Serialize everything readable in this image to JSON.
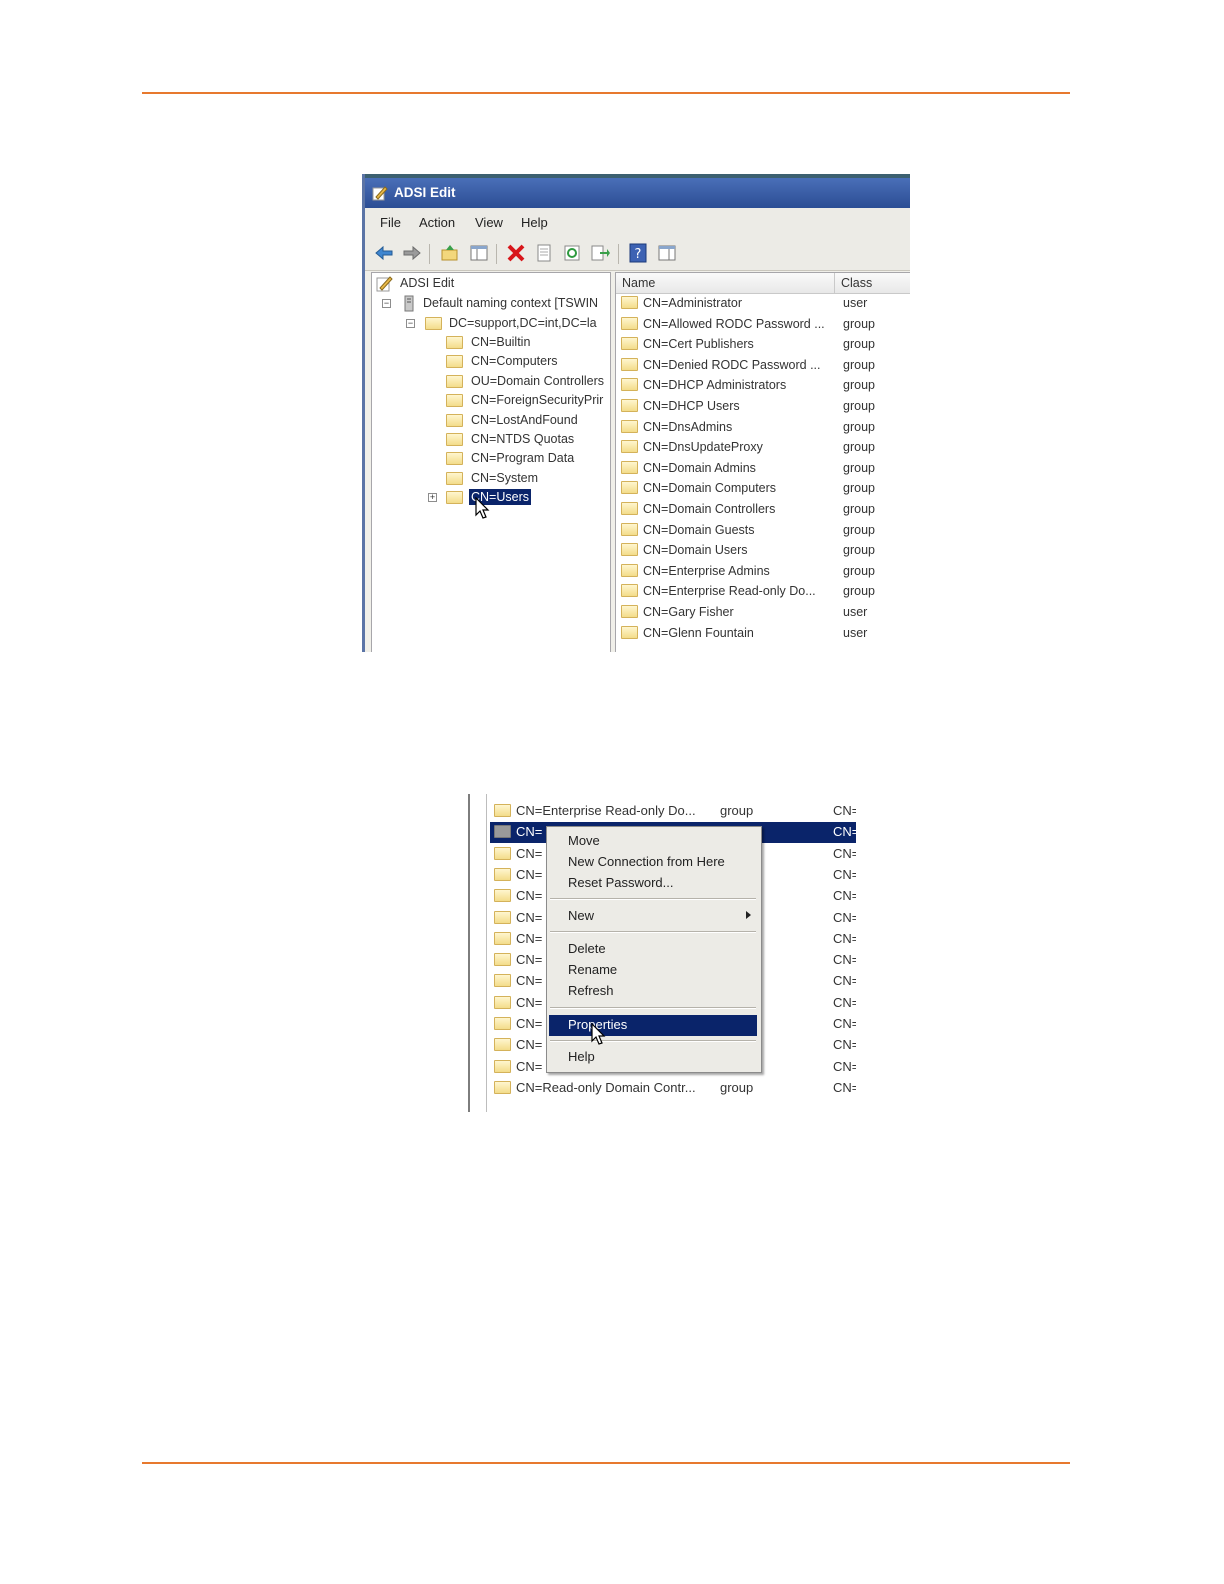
{
  "shot1": {
    "window_title": "ADSI Edit",
    "menu": [
      "File",
      "Action",
      "View",
      "Help"
    ],
    "tree": [
      {
        "label": "ADSI Edit"
      },
      {
        "label": "Default naming context [TSWIN"
      },
      {
        "label": "DC=support,DC=int,DC=la"
      },
      {
        "label": "CN=Builtin"
      },
      {
        "label": "CN=Computers"
      },
      {
        "label": "OU=Domain Controllers"
      },
      {
        "label": "CN=ForeignSecurityPrir"
      },
      {
        "label": "CN=LostAndFound"
      },
      {
        "label": "CN=NTDS Quotas"
      },
      {
        "label": "CN=Program Data"
      },
      {
        "label": "CN=System"
      },
      {
        "label": "CN=Users"
      }
    ],
    "columns": [
      "Name",
      "Class"
    ],
    "rows": [
      {
        "name": "CN=Administrator",
        "class": "user"
      },
      {
        "name": "CN=Allowed RODC Password ...",
        "class": "group"
      },
      {
        "name": "CN=Cert Publishers",
        "class": "group"
      },
      {
        "name": "CN=Denied RODC Password ...",
        "class": "group"
      },
      {
        "name": "CN=DHCP Administrators",
        "class": "group"
      },
      {
        "name": "CN=DHCP Users",
        "class": "group"
      },
      {
        "name": "CN=DnsAdmins",
        "class": "group"
      },
      {
        "name": "CN=DnsUpdateProxy",
        "class": "group"
      },
      {
        "name": "CN=Domain Admins",
        "class": "group"
      },
      {
        "name": "CN=Domain Computers",
        "class": "group"
      },
      {
        "name": "CN=Domain Controllers",
        "class": "group"
      },
      {
        "name": "CN=Domain Guests",
        "class": "group"
      },
      {
        "name": "CN=Domain Users",
        "class": "group"
      },
      {
        "name": "CN=Enterprise Admins",
        "class": "group"
      },
      {
        "name": "CN=Enterprise Read-only Do...",
        "class": "group"
      },
      {
        "name": "CN=Gary Fisher",
        "class": "user"
      },
      {
        "name": "CN=Glenn Fountain",
        "class": "user"
      }
    ]
  },
  "shot2": {
    "rows": [
      {
        "name": "CN=Enterprise Read-only Do...",
        "class": "group",
        "cn": "CN="
      },
      {
        "name": "CN=",
        "class": "",
        "cn": "CN="
      },
      {
        "name": "CN=",
        "class": "",
        "cn": "CN="
      },
      {
        "name": "CN=",
        "class": "",
        "cn": "CN="
      },
      {
        "name": "CN=",
        "class": "",
        "cn": "CN="
      },
      {
        "name": "CN=",
        "class": "",
        "cn": "CN="
      },
      {
        "name": "CN=",
        "class": "",
        "cn": "CN="
      },
      {
        "name": "CN=",
        "class": "",
        "cn": "CN="
      },
      {
        "name": "CN=",
        "class": "",
        "cn": "CN="
      },
      {
        "name": "CN=",
        "class": "",
        "cn": "CN="
      },
      {
        "name": "CN=",
        "class": "",
        "cn": "CN="
      },
      {
        "name": "CN=",
        "class": "",
        "cn": "CN="
      },
      {
        "name": "CN=",
        "class": "",
        "cn": "CN="
      },
      {
        "name": "CN=Read-only Domain Contr...",
        "class": "group",
        "cn": "CN="
      }
    ],
    "menu_items": {
      "move": "Move",
      "new_connection": "New Connection from Here",
      "reset_password": "Reset Password...",
      "new": "New",
      "delete": "Delete",
      "rename": "Rename",
      "refresh": "Refresh",
      "properties": "Properties",
      "help": "Help"
    }
  },
  "colors": {
    "rule": "#e7792e",
    "selection": "#0a246a"
  }
}
